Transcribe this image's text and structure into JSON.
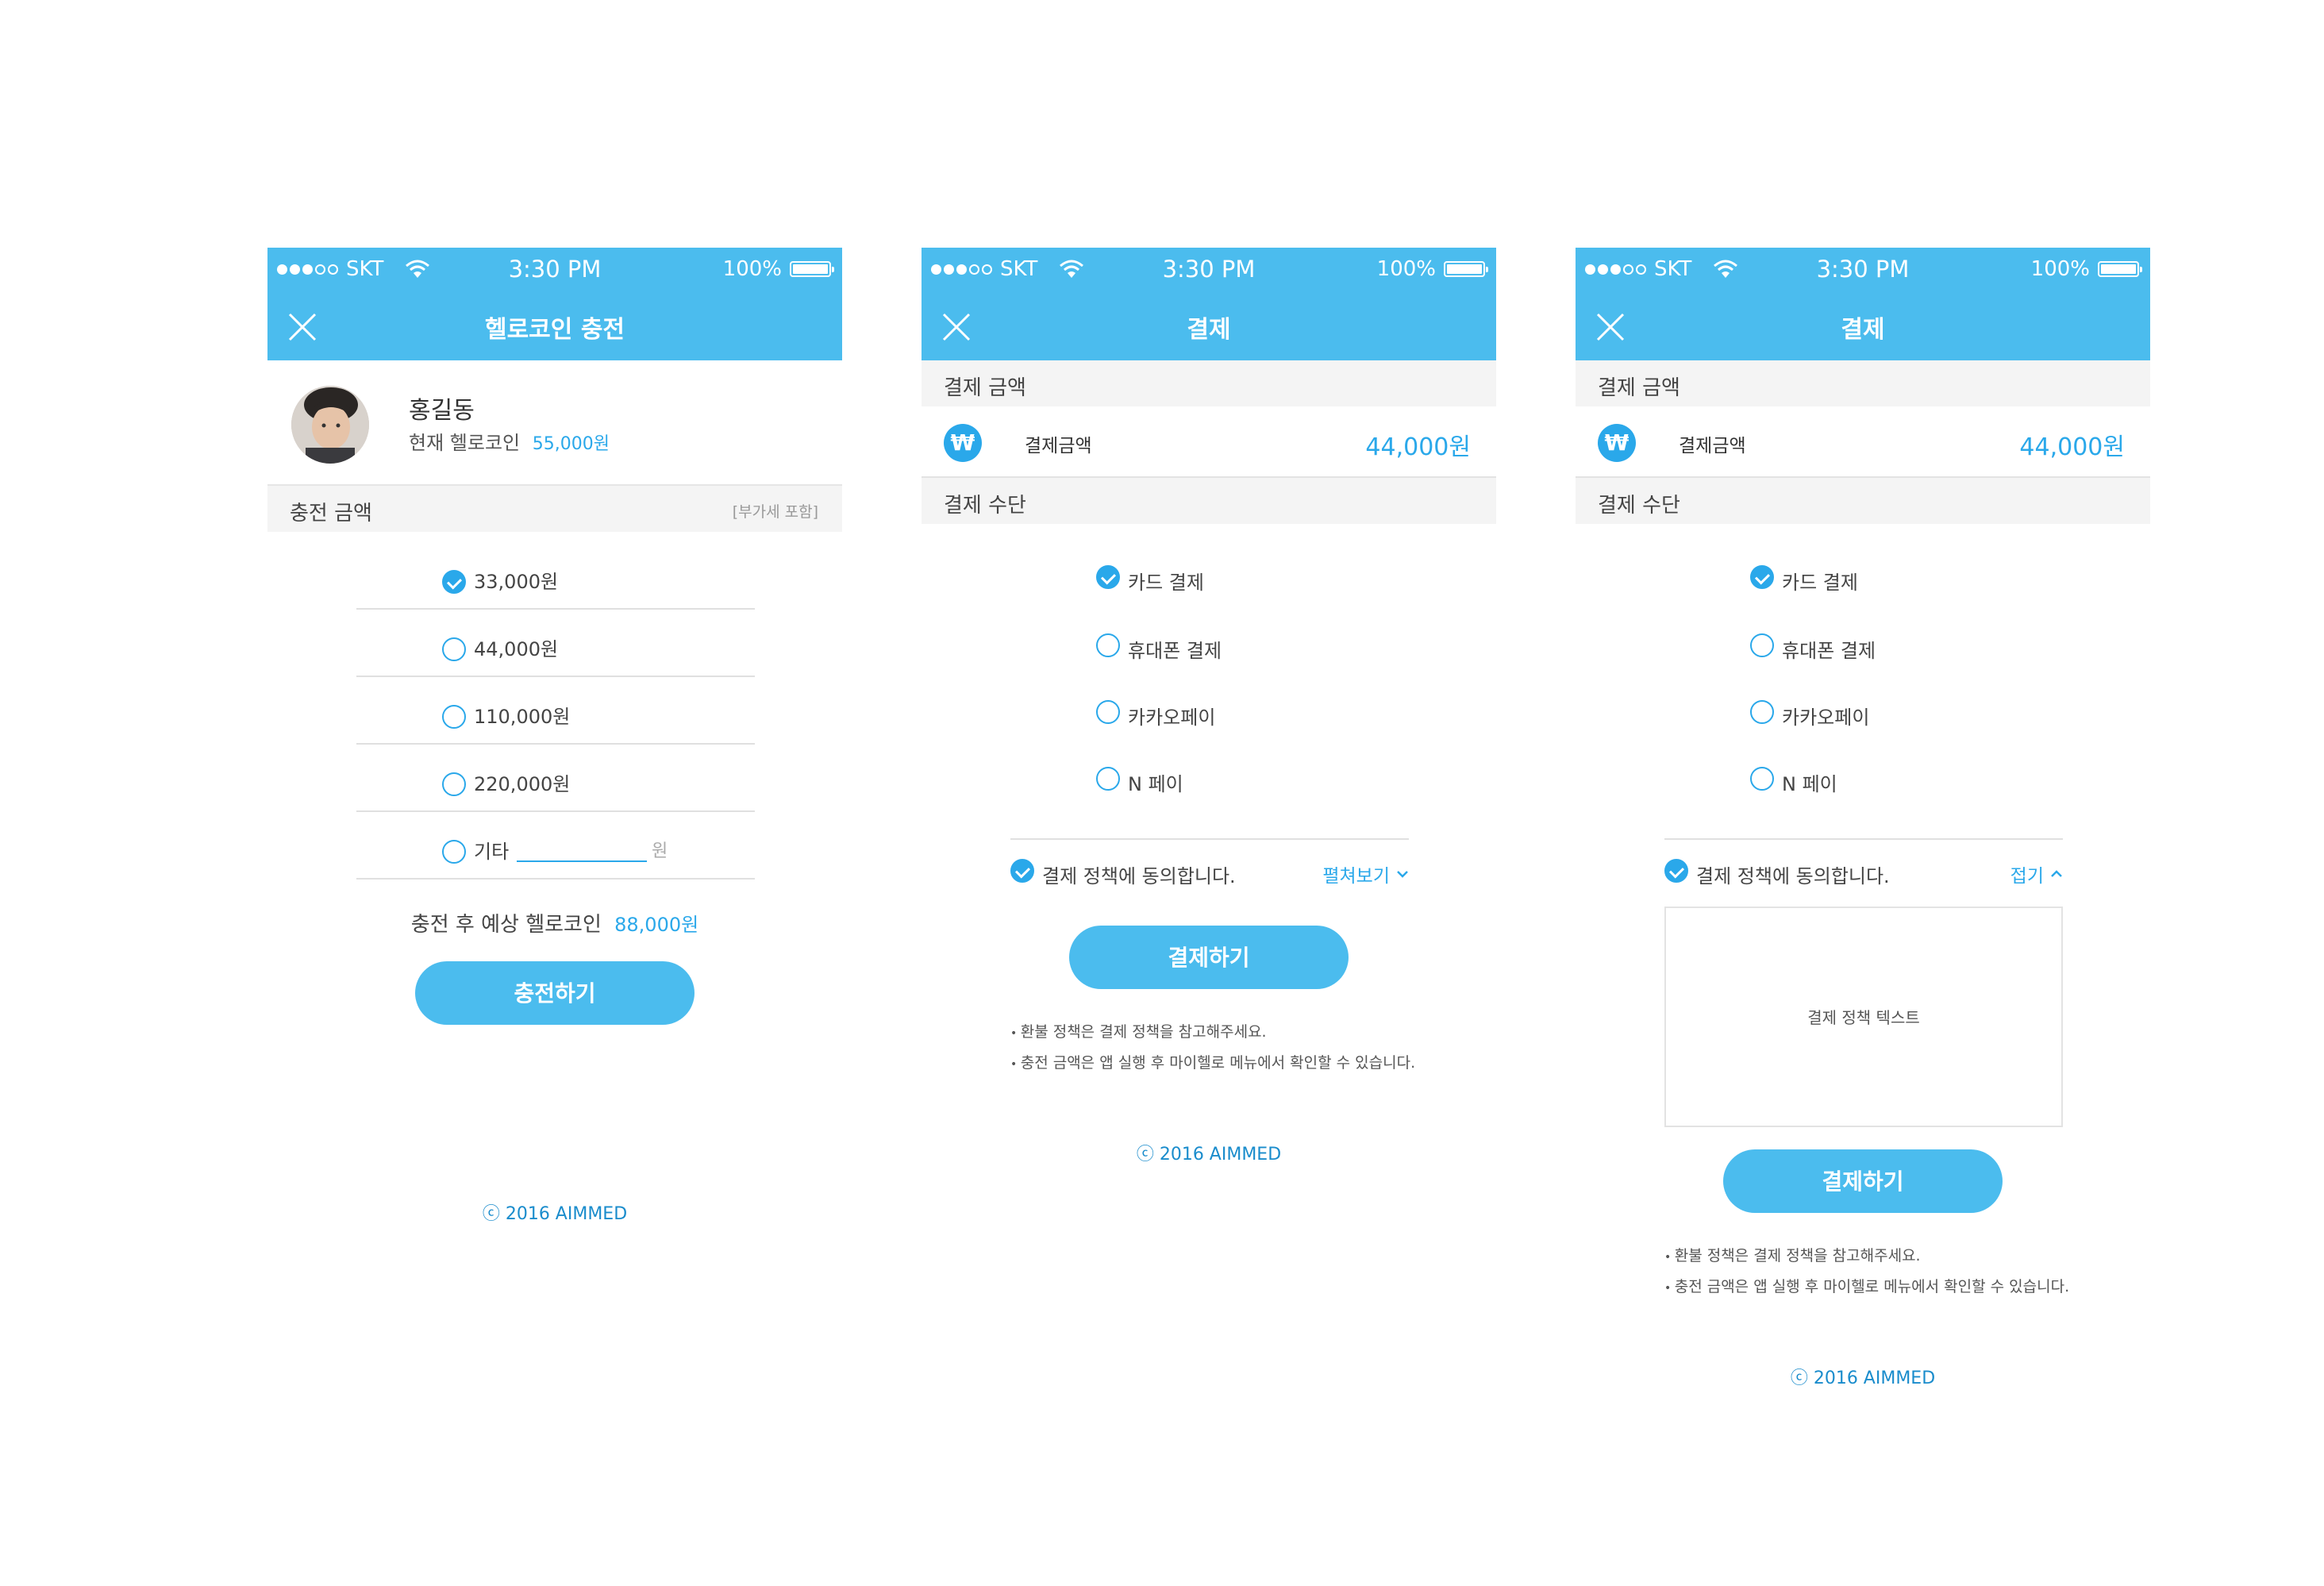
{
  "status": {
    "carrier": "SKT",
    "time": "3:30 PM",
    "battery": "100%"
  },
  "screen1": {
    "title": "헬로코인 충전",
    "user_name": "홍길동",
    "coin_label": "현재 헬로코인",
    "coin_value": "55,000원",
    "section_label": "충전 금액",
    "section_note": "[부가세 포함]",
    "options": [
      {
        "label": "33,000원",
        "selected": true
      },
      {
        "label": "44,000원",
        "selected": false
      },
      {
        "label": "110,000원",
        "selected": false
      },
      {
        "label": "220,000원",
        "selected": false
      }
    ],
    "other_label": "기타",
    "other_unit": "원",
    "expected_label": "충전 후 예상 헬로코인",
    "expected_value": "88,000원",
    "button": "충전하기",
    "copyright": "ⓒ 2016 AIMMED"
  },
  "payment": {
    "title": "결제",
    "amount_section": "결제 금액",
    "won_symbol": "₩",
    "amount_label": "결제금액",
    "amount_value": "44,000원",
    "method_section": "결제 수단",
    "methods": [
      {
        "label": "카드 결제",
        "selected": true
      },
      {
        "label": "휴대폰 결제",
        "selected": false
      },
      {
        "label": "카카오페이",
        "selected": false
      },
      {
        "label": "N 페이",
        "selected": false
      }
    ],
    "agree_label": "결제 정책에 동의합니다.",
    "expand_label": "펼쳐보기",
    "collapse_label": "접기",
    "policy_text": "결제 정책 텍스트",
    "button": "결제하기",
    "notes": [
      "환불 정책은 결제 정책을 참고해주세요.",
      "충전 금액은 앱 실행 후 마이헬로 메뉴에서 확인할 수 있습니다."
    ],
    "copyright": "ⓒ 2016 AIMMED"
  },
  "colors": {
    "accent": "#4bbcee",
    "accent_text": "#2aa8ea",
    "section_bg": "#f4f4f4"
  },
  "icons": [
    "signal-dots-icon",
    "wifi-icon",
    "battery-icon",
    "close-icon",
    "won-icon",
    "check-icon",
    "chevron-down-icon",
    "chevron-up-icon"
  ]
}
